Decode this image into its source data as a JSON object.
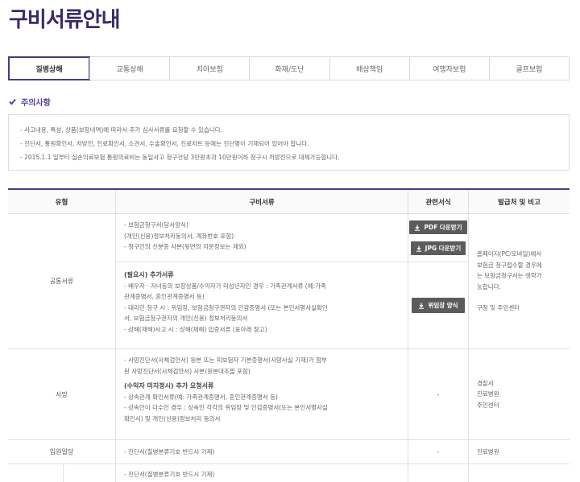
{
  "page": {
    "title": "구비서류안내"
  },
  "tabs": [
    {
      "label": "질병상해",
      "active": true
    },
    {
      "label": "교통상해"
    },
    {
      "label": "치아보험"
    },
    {
      "label": "화재/도난"
    },
    {
      "label": "배상책임"
    },
    {
      "label": "여행자보험"
    },
    {
      "label": "골프보험"
    }
  ],
  "notice": {
    "title": "주의사항",
    "lines": [
      "- 사고내용, 특성, 상품(보장내역)에 따라서 추가 심사서류를 요청할 수 있습니다.",
      "- 진단서, 통원확인서, 처방전, 진료확인서, 소견서, 수술확인서, 진료차트 등에는 진단명이 기재되어 있어야 합니다.",
      "- 2015.1.1 일부터 실손의료보험 통원의료비는 동일사고 청구건당 3만원초과 10만원이하 청구시 처방전으로 대체가능합니다."
    ]
  },
  "table": {
    "headers": [
      "유형",
      "구비서류",
      "관련서식",
      "발급처 및 비고"
    ],
    "rows": [
      {
        "type": "공통서류",
        "doc_lines_1": [
          "- 보험금청구서(당사양식)",
          "  (개인(신용)정보처리동의서, 계좌번호 포함)",
          "- 청구인의 신분증 사본(뒷면의 지문정보는 제외)"
        ],
        "doc_sub_2": "(필요시) 추가서류",
        "doc_lines_2": [
          "- 배우자 · 자녀등의 보장상품/수익자가 미성년자인 경우 : 가족관계서류 (예:가족",
          "  관계증명서, 혼인관계증명서 등)",
          "- 대리인 청구 시 : 위임장, 보험금청구권자의 인감증명서 (또는 본인서명사실확인",
          "  서, 보험금청구권자의 개인(신용) 정보처리동의서",
          "- 상해(재해)사고 시 : 상해(재해) 입증서류 (표아래 참고)"
        ],
        "form_pdf": "PDF 다운받기",
        "form_jpg": "JPG 다운받기",
        "form_proxy": "위임장 양식",
        "remark_lines": [
          "홈페이지(PC/모바일)에서",
          "보험금 청구접수할 경우에",
          "는 보험금청구서는 생략가",
          "능합니다.",
          "",
          "구청 및 주민센터"
        ]
      },
      {
        "type": "사망",
        "doc_lines_1": [
          "- 사망진단서(사체검안서) 원본 또는 피보험자 기본증명서(사망사실 기재)가 첨부",
          "  된 사망진단서(사체검안서) 사본(원본대조필 포함)"
        ],
        "doc_sub_2": "(수익자 미지정시) 추가 요청서류",
        "doc_lines_2": [
          "- 상속관계 확인서류(예: 가족관계증명서, 혼인관계증명서 등)",
          "- 상속인이 다수인 경우 : 상속인 각각의 위임장 및 인감증명서(또는 본인서명사실",
          "  확인서) 및 개인(신용)정보처리 동의서"
        ],
        "form": "-",
        "remark_lines": [
          "경찰서",
          "진료병원",
          "주민센터"
        ]
      },
      {
        "type": "입원일당",
        "doc_lines_1": [
          "- 진단서(질병분류기호 반드시 기재)"
        ],
        "form": "-",
        "remark_lines": [
          "진료병원"
        ]
      },
      {
        "type": "",
        "doc_lines_1": [
          "- 진단서(질병분류기호 반드시 기재)"
        ]
      }
    ]
  },
  "colors": {
    "brand": "#4a3a82",
    "accent": "#5a3f9c",
    "button": "#5b5b5b"
  },
  "icons": {
    "notice": "check-icon",
    "download": "download-icon"
  }
}
